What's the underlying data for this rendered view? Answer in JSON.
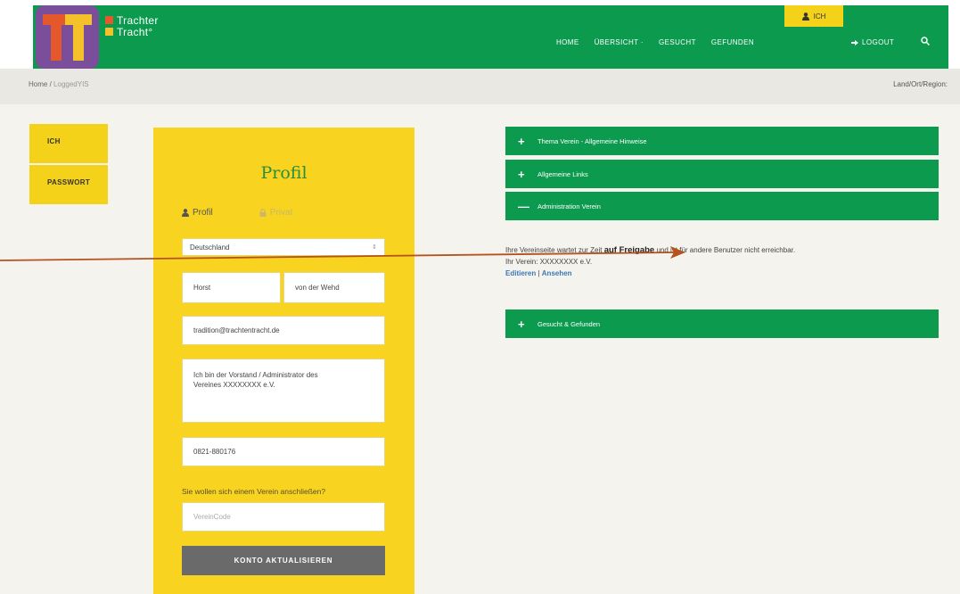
{
  "brand": {
    "line1": "Trachter",
    "line2": "Tracht°",
    "logo_letters": "TT"
  },
  "nav": {
    "items": [
      "HOME",
      "ÜBERSICHT ·",
      "GESUCHT",
      "GEFUNDEN"
    ],
    "ich": "ICH",
    "logout": "LOGOUT"
  },
  "breadcrumb": {
    "home": "Home",
    "separator": "/",
    "current": "LoggedYIS"
  },
  "region_label": "Land/Ort/Region:",
  "sidebar": {
    "items": [
      "ICH",
      "PASSWORT"
    ]
  },
  "profile": {
    "title": "Profil",
    "tab_profil": "Profil",
    "tab_privat": "Privat",
    "country": "Deutschland",
    "first_name": "Horst",
    "last_name": "von der Wehd",
    "email": "tradition@trachtentracht.de",
    "about": "Ich bin der Vorstand / Administrator des\nVereines XXXXXXXX e.V.",
    "phone": "0821-880176",
    "join_question": "Sie wollen sich einem Verein anschließen?",
    "vereincode_placeholder": "VereinCode",
    "submit_label": "KONTO AKTUALISIEREN"
  },
  "accordion": {
    "items": [
      {
        "label": "Thema Verein - Allgemeine Hinweise",
        "sign": "+"
      },
      {
        "label": "Allgemeine Links",
        "sign": "+"
      },
      {
        "label": "Administration Verein",
        "sign": "—"
      },
      {
        "label": "Gesucht & Gefunden",
        "sign": "+"
      }
    ]
  },
  "notice": {
    "pre": "Ihre Vereinseite wartet zur Zeit ",
    "strong": "auf Freigabe",
    "post": " und ist für andere Benutzer nicht erreichbar.",
    "verein_line": "Ihr Verein: XXXXXXXX e.V.",
    "edit_link": "Editieren",
    "sep": "|",
    "view_link": "Ansehen"
  },
  "colors": {
    "green": "#0b9a4e",
    "yellow": "#f8d31f",
    "purple": "#7b4e9c",
    "arrow": "#b4531f"
  }
}
